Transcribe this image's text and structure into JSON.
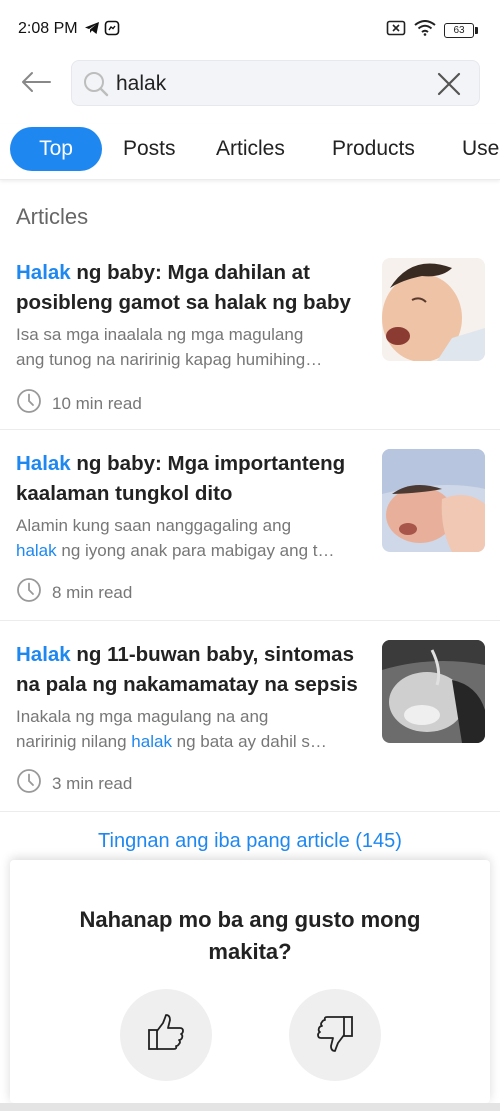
{
  "status_bar": {
    "time": "2:08 PM",
    "battery_level": "63",
    "icons": [
      "telegram-icon",
      "messenger-icon",
      "sim-off-icon",
      "wifi-icon",
      "battery-icon"
    ]
  },
  "search": {
    "query": "halak",
    "icons": [
      "back-arrow-icon",
      "search-icon",
      "clear-icon"
    ]
  },
  "tabs": [
    {
      "label": "Top",
      "active": true
    },
    {
      "label": "Posts",
      "active": false
    },
    {
      "label": "Articles",
      "active": false
    },
    {
      "label": "Products",
      "active": false
    },
    {
      "label": "Use",
      "active": false
    }
  ],
  "section_title": "Articles",
  "articles": [
    {
      "title_highlight": "Halak",
      "title_line1_rest": " ng baby: Mga dahilan at",
      "title_line2": "posibleng gamot sa halak ng baby",
      "snippet_line1": "Isa sa mga inaalala ng mga magulang",
      "snippet_line2": "ang tunog na naririnig kapag humihing…",
      "read_time": "10 min read"
    },
    {
      "title_highlight": "Halak",
      "title_line1_rest": " ng baby: Mga importanteng",
      "title_line2": "kaalaman tungkol dito",
      "snippet_line1": "Alamin kung saan nanggagaling ang",
      "snippet_line2_hl": "halak",
      "snippet_line2_rest": " ng iyong anak para mabigay ang t…",
      "read_time": "8 min read"
    },
    {
      "title_highlight": "Halak",
      "title_line1_rest": " ng 11-buwan baby, sintomas",
      "title_line2": "na pala ng nakamamatay na sepsis",
      "snippet_line1": "Inakala ng mga magulang na ang",
      "snippet_line2_pre": "naririnig nilang ",
      "snippet_line2_hl": "halak",
      "snippet_line2_rest": " ng bata ay dahil s…",
      "read_time": "3 min read"
    }
  ],
  "more_link": "Tingnan ang iba pang article (145)",
  "feedback": {
    "question_line1": "Nahanap mo ba ang gusto mong",
    "question_line2": "makita?",
    "icons": [
      "thumbs-up-icon",
      "thumbs-down-icon"
    ]
  },
  "colors": {
    "accent": "#1e88f0",
    "text": "#222222",
    "muted": "#777777",
    "search_bg": "#f3f4f7"
  }
}
